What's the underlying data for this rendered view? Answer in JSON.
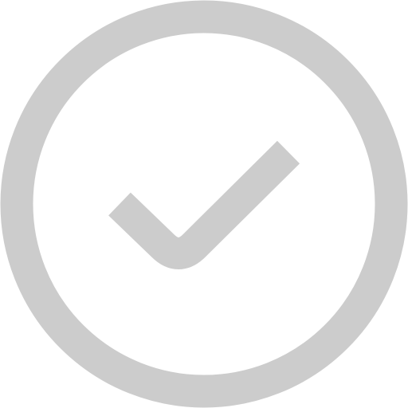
{
  "icon": {
    "name": "check-circle-icon",
    "state": "inactive",
    "color": "#cccccc"
  }
}
